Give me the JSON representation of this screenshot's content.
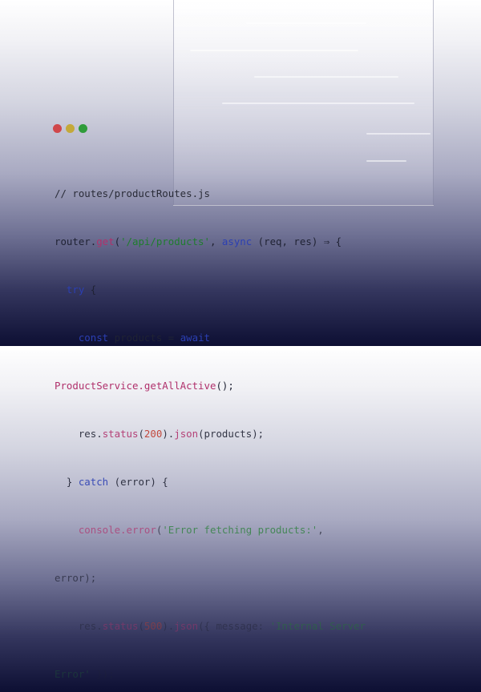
{
  "code": {
    "comment": "// routes/productRoutes.js",
    "l2_router": "router.",
    "l2_get": "get",
    "l2_open": "(",
    "l2_path": "'/api/products'",
    "l2_comma": ", ",
    "l2_async": "async",
    "l2_rest": " (req, res) ⇒ {",
    "l3_try": "try",
    "l3_brace": " {",
    "l4_const": "const",
    "l4_mid": " products = ",
    "l4_await": "await",
    "l5_service": "ProductService.",
    "l5_fn": "getAllActive",
    "l5_rest": "();",
    "l6_res": "res.",
    "l6_status": "status",
    "l6_open": "(",
    "l6_code": "200",
    "l6_close": ").",
    "l6_json": "json",
    "l6_rest": "(products);",
    "l7_close": "} ",
    "l7_catch": "catch",
    "l7_rest": " (error) {",
    "l8_console": "console.",
    "l8_error": "error",
    "l8_open": "(",
    "l8_str": "'Error fetching products:'",
    "l8_comma": ",",
    "l9": "error);",
    "l10_res": "res.",
    "l10_status": "status",
    "l10_open": "(",
    "l10_code": "500",
    "l10_close": ").",
    "l10_json": "json",
    "l10_rest": "({ message: ",
    "l10_str": "'Internal Server",
    "l11_str": "Error'",
    "l11_rest": " });"
  },
  "colors": {
    "keyword": "#2b3fb3",
    "function": "#b0306b",
    "string": "#1f7d2e",
    "number": "#c0392b"
  }
}
